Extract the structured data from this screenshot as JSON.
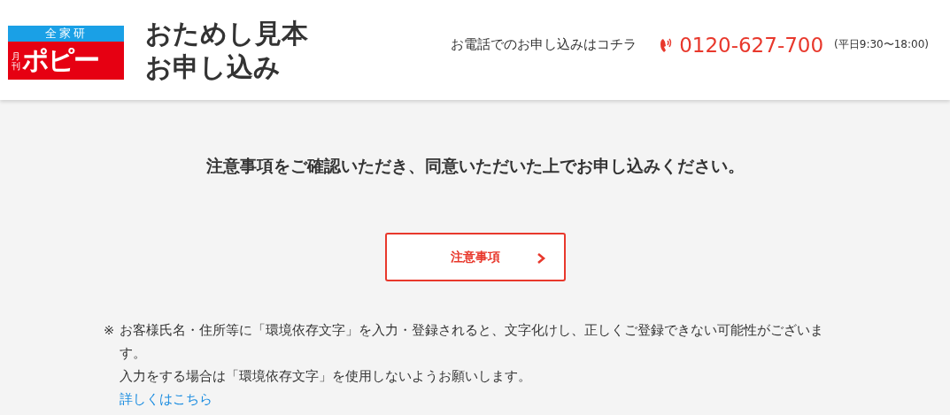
{
  "header": {
    "logo": {
      "top": "全家研",
      "side": "月刊",
      "name": "ポピー"
    },
    "title_lines": [
      "おためし見本",
      "お申し込み"
    ],
    "phone": {
      "label": "お電話でのお申し込みはコチラ",
      "number": "0120-627-700",
      "hours": "(平日9:30〜18:00)"
    }
  },
  "main": {
    "heading": "注意事項をご確認いただき、同意いただいた上でお申し込みください。",
    "button": "注意事項",
    "notes": [
      {
        "kind": "mark",
        "text": "お客様氏名・住所等に「環境依存文字」を入力・登録されると、文字化けし、正しくご登録できない可能性がございます。",
        "mark": "※"
      },
      {
        "kind": "plain",
        "text": "入力をする場合は「環境依存文字」を使用しないようお願いします。"
      },
      {
        "kind": "link",
        "text": "詳しくはこちら"
      }
    ]
  }
}
